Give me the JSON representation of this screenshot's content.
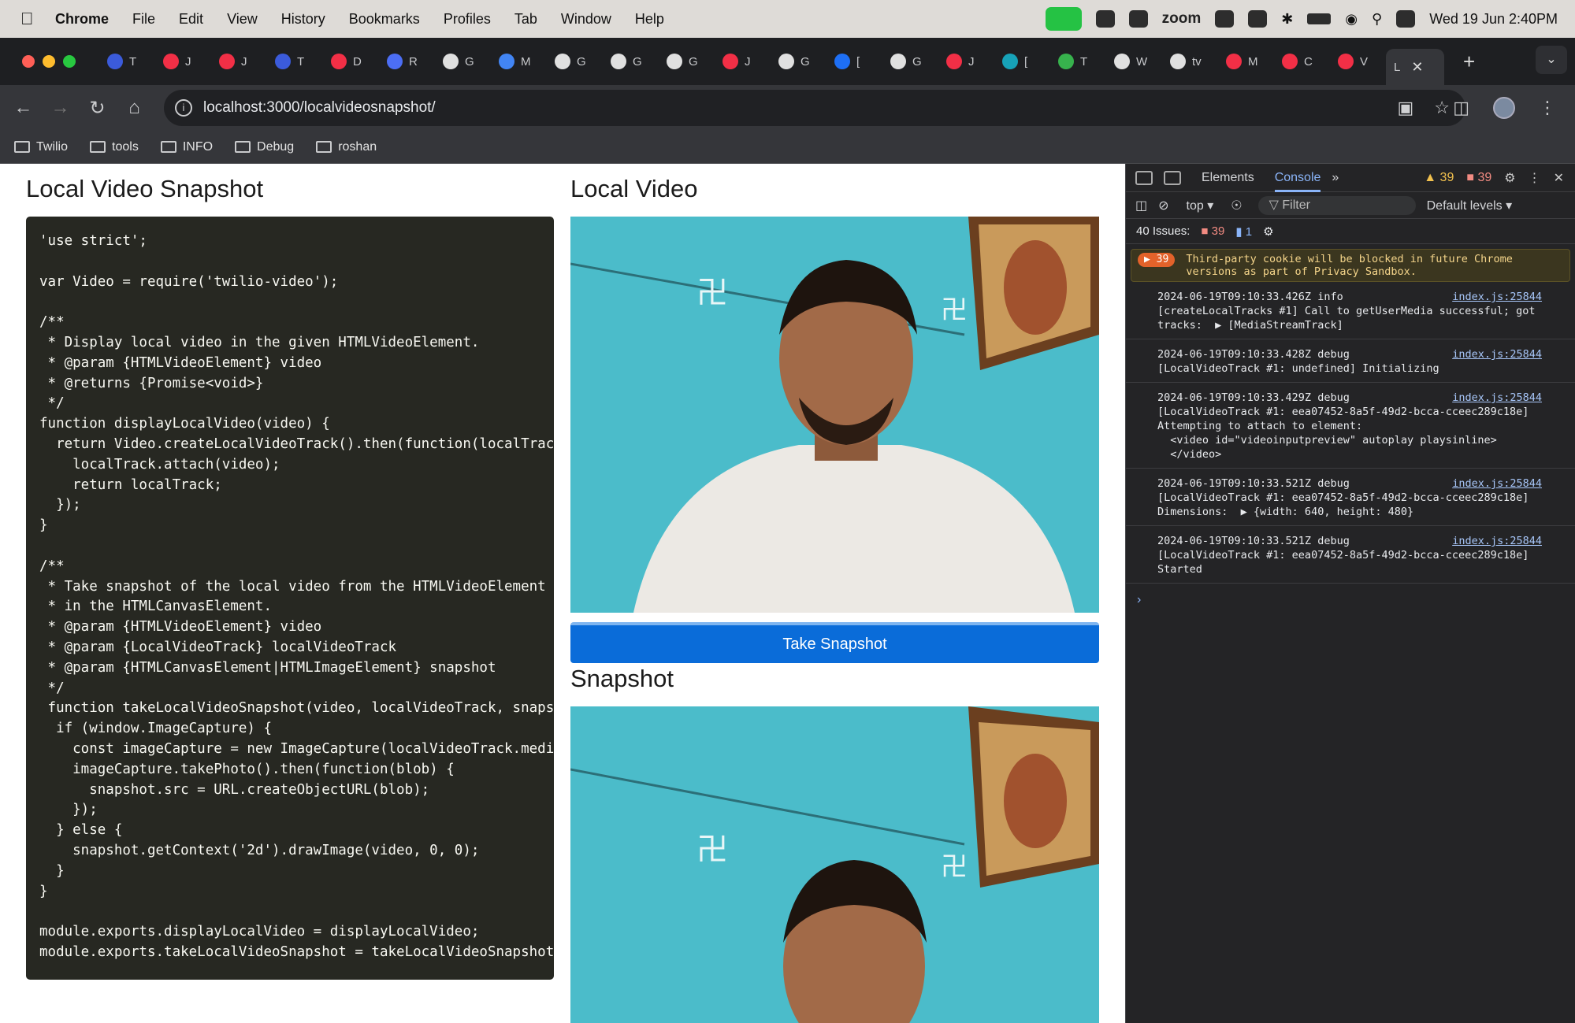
{
  "menubar": {
    "app": "Chrome",
    "items": [
      "File",
      "Edit",
      "View",
      "History",
      "Bookmarks",
      "Profiles",
      "Tab",
      "Window",
      "Help"
    ],
    "zoom_label": "zoom",
    "clock": "Wed 19 Jun  2:40PM"
  },
  "tabs": [
    {
      "label": "T",
      "color": "#3b5bdb"
    },
    {
      "label": "J",
      "color": "#f22f46"
    },
    {
      "label": "J",
      "color": "#f22f46"
    },
    {
      "label": "T",
      "color": "#3b5bdb"
    },
    {
      "label": "D",
      "color": "#f22f46"
    },
    {
      "label": "R",
      "color": "#4c6ef5"
    },
    {
      "label": "G",
      "color": "#e0e0e0"
    },
    {
      "label": "M",
      "color": "#4285f4"
    },
    {
      "label": "G",
      "color": "#e0e0e0"
    },
    {
      "label": "G",
      "color": "#e0e0e0"
    },
    {
      "label": "G",
      "color": "#e0e0e0"
    },
    {
      "label": "J",
      "color": "#f22f46"
    },
    {
      "label": "G",
      "color": "#e0e0e0"
    },
    {
      "label": "[",
      "color": "#1e6ff5"
    },
    {
      "label": "G",
      "color": "#e0e0e0"
    },
    {
      "label": "J",
      "color": "#f22f46"
    },
    {
      "label": "[",
      "color": "#17a2b8"
    },
    {
      "label": "T",
      "color": "#37b24d"
    },
    {
      "label": "W",
      "color": "#e0e0e0"
    },
    {
      "label": "tv",
      "color": "#e0e0e0"
    },
    {
      "label": "M",
      "color": "#f22f46"
    },
    {
      "label": "C",
      "color": "#f22f46"
    },
    {
      "label": "V",
      "color": "#f22f46"
    }
  ],
  "active_tab": {
    "label": "L"
  },
  "address": {
    "url": "localhost:3000/localvideosnapshot/"
  },
  "bookmarks": [
    "Twilio",
    "tools",
    "INFO",
    "Debug",
    "roshan"
  ],
  "page": {
    "left_title": "Local Video Snapshot",
    "video_title": "Local Video",
    "button": "Take Snapshot",
    "snapshot_title": "Snapshot"
  },
  "devtools": {
    "tabs": [
      "Elements",
      "Console"
    ],
    "warn_count": "39",
    "err_count": "39",
    "context": "top",
    "filter_placeholder": "Filter",
    "levels": "Default levels",
    "issues_label": "40 Issues:",
    "issues_err": "39",
    "issues_info": "1",
    "cookie_count": "39",
    "cookie_msg": "Third-party cookie will be blocked in future Chrome versions as part of Privacy Sandbox.",
    "logs": [
      {
        "text": "2024-06-19T09:10:33.426Z info\n[createLocalTracks #1] Call to getUserMedia successful; got tracks:  ▶ [MediaStreamTrack]",
        "src": "index.js:25844"
      },
      {
        "text": "2024-06-19T09:10:33.428Z debug\n[LocalVideoTrack #1: undefined] Initializing",
        "src": "index.js:25844"
      },
      {
        "text": "2024-06-19T09:10:33.429Z debug\n[LocalVideoTrack #1: eea07452-8a5f-49d2-bcca-cceec289c18e] Attempting to attach to element:\n  <video id=\"videoinputpreview\" autoplay playsinline>\n  </video>",
        "src": "index.js:25844"
      },
      {
        "text": "2024-06-19T09:10:33.521Z debug\n[LocalVideoTrack #1: eea07452-8a5f-49d2-bcca-cceec289c18e] Dimensions:  ▶ {width: 640, height: 480}",
        "src": "index.js:25844"
      },
      {
        "text": "2024-06-19T09:10:33.521Z debug\n[LocalVideoTrack #1: eea07452-8a5f-49d2-bcca-cceec289c18e] Started",
        "src": "index.js:25844"
      }
    ]
  },
  "code_lines": [
    "'use strict';",
    "",
    "var Video = require('twilio-video');",
    "",
    "/**",
    " * Display local video in the given HTMLVideoElement.",
    " * @param {HTMLVideoElement} video",
    " * @returns {Promise<void>}",
    " */",
    "function displayLocalVideo(video) {",
    "  return Video.createLocalVideoTrack().then(function(localTrack",
    "    localTrack.attach(video);",
    "    return localTrack;",
    "  });",
    "}",
    "",
    "/**",
    " * Take snapshot of the local video from the HTMLVideoElement ar",
    " * in the HTMLCanvasElement.",
    " * @param {HTMLVideoElement} video",
    " * @param {LocalVideoTrack} localVideoTrack",
    " * @param {HTMLCanvasElement|HTMLImageElement} snapshot",
    " */",
    " function takeLocalVideoSnapshot(video, localVideoTrack, snapsho",
    "  if (window.ImageCapture) {",
    "    const imageCapture = new ImageCapture(localVideoTrack.mediaS",
    "    imageCapture.takePhoto().then(function(blob) {",
    "      snapshot.src = URL.createObjectURL(blob);",
    "    });",
    "  } else {",
    "    snapshot.getContext('2d').drawImage(video, 0, 0);",
    "  }",
    "}",
    "",
    "module.exports.displayLocalVideo = displayLocalVideo;",
    "module.exports.takeLocalVideoSnapshot = takeLocalVideoSnapshot;"
  ]
}
